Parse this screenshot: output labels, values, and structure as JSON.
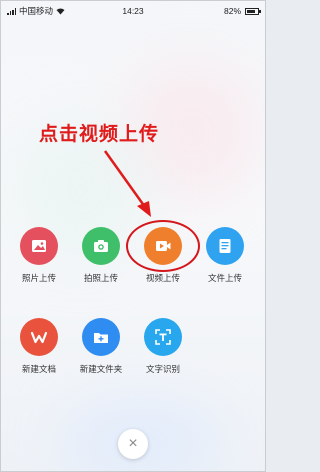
{
  "status_bar": {
    "carrier": "中国移动",
    "time": "14:23",
    "battery_percent": "82%",
    "battery_level": 0.82
  },
  "annotation": {
    "text": "点击视频上传",
    "color": "#e01b1b"
  },
  "menu": {
    "row1": [
      {
        "label": "照片上传",
        "icon": "photo-icon",
        "color": "#e4505d"
      },
      {
        "label": "拍照上传",
        "icon": "camera-icon",
        "color": "#3fbf6a"
      },
      {
        "label": "视频上传",
        "icon": "video-icon",
        "color": "#ef7f2c"
      },
      {
        "label": "文件上传",
        "icon": "document-icon",
        "color": "#2fa3f0"
      }
    ],
    "row2": [
      {
        "label": "新建文档",
        "icon": "wps-icon",
        "color": "#e9533d"
      },
      {
        "label": "新建文件夹",
        "icon": "new-folder-icon",
        "color": "#2f8cf0"
      },
      {
        "label": "文字识别",
        "icon": "text-recognition-icon",
        "color": "#28a7ee"
      }
    ]
  },
  "close_button": {
    "label": "×"
  }
}
